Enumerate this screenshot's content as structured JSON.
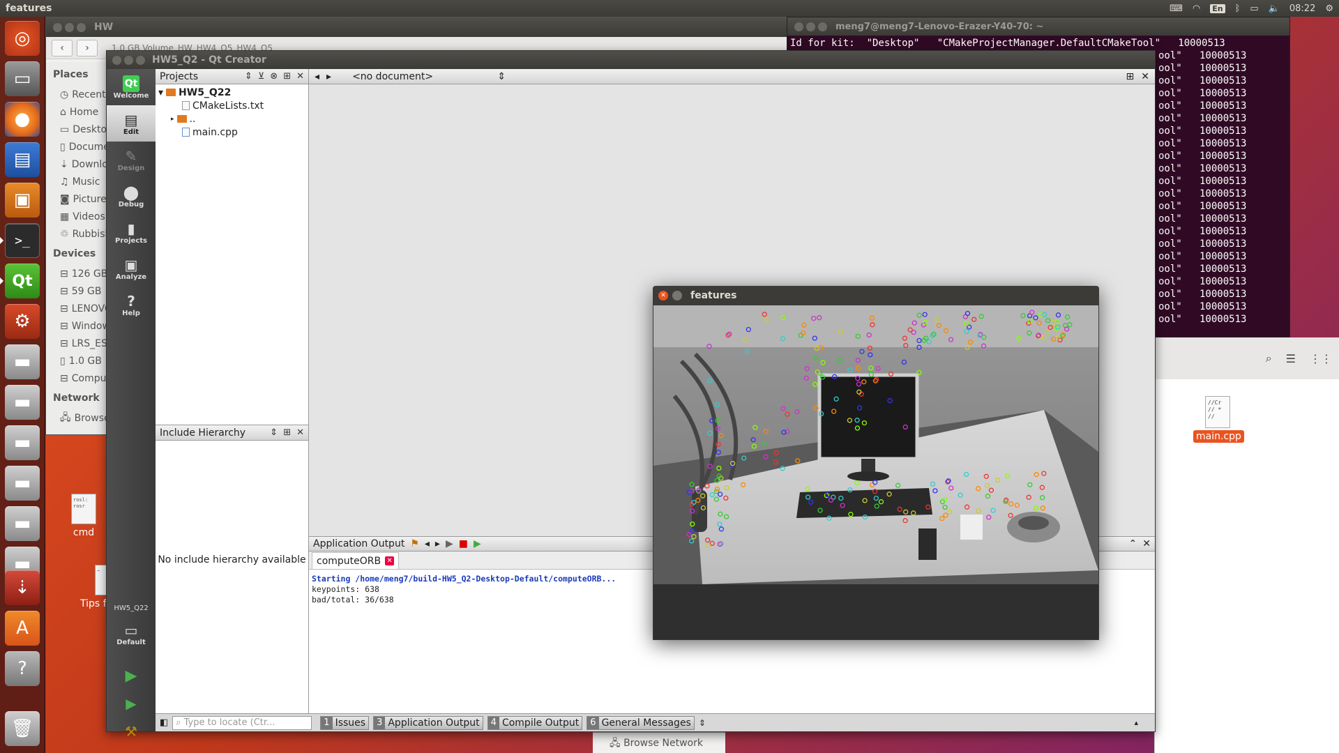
{
  "top_panel": {
    "app_title": "features",
    "lang": "En",
    "time": "08:22"
  },
  "launcher": {
    "items": [
      "ubuntu-dash",
      "files",
      "firefox",
      "writer",
      "impress",
      "terminal",
      "qt-creator",
      "system-settings",
      "drive",
      "drive",
      "drive",
      "drive",
      "drive",
      "drive",
      "usb",
      "software-center",
      "help",
      "trash"
    ]
  },
  "desktop": {
    "icon1_label": "cmd",
    "icon2_label": "Tips f",
    "browse_network": "Browse Network"
  },
  "nautilus": {
    "title": "HW",
    "tabs": [
      "1.0 GB Volume",
      "HW",
      "HW4_Q5",
      "HW4_Q5"
    ],
    "places_header": "Places",
    "places": [
      "Recent",
      "Home",
      "Desktop",
      "Documents",
      "Downloads",
      "Music",
      "Pictures",
      "Videos",
      "Rubbish Bin"
    ],
    "devices_header": "Devices",
    "devices": [
      "126 GB",
      "59 GB",
      "LENOVO",
      "Windows",
      "LRS_ESP",
      "1.0 GB",
      "Computer"
    ],
    "network_header": "Network",
    "network": [
      "Browse Network"
    ]
  },
  "terminal": {
    "title": "meng7@meng7-Lenovo-Erazer-Y40-70: ~",
    "first_line": "Id for kit:  \"Desktop\"   \"CMakeProjectManager.DefaultCMakeTool\"   10000513",
    "repeat_line": "ool\"   10000513",
    "repeat_count": 22
  },
  "files_window": {
    "file_label": "main.cpp"
  },
  "qtc": {
    "title": "HW5_Q2 - Qt Creator",
    "modes": [
      {
        "label": "Welcome",
        "icon": "qt-logo-icon"
      },
      {
        "label": "Edit",
        "icon": "edit-icon"
      },
      {
        "label": "Design",
        "icon": "design-icon"
      },
      {
        "label": "Debug",
        "icon": "debug-icon"
      },
      {
        "label": "Projects",
        "icon": "projects-icon"
      },
      {
        "label": "Analyze",
        "icon": "analyze-icon"
      },
      {
        "label": "Help",
        "icon": "help-icon"
      }
    ],
    "kit_project": "HW5_Q22",
    "kit_label": "Default",
    "projects_header": "Projects",
    "tree": {
      "root": "HW5_Q22",
      "file1": "CMakeLists.txt",
      "folder": "..",
      "file2": "main.cpp"
    },
    "include_header": "Include Hierarchy",
    "include_msg": "No include hierarchy available",
    "doc_selector": "<no document>",
    "output_header": "Application Output",
    "output_tab": "computeORB",
    "output_lines": [
      "Starting /home/meng7/build-HW5_Q2-Desktop-Default/computeORB...",
      "keypoints: 638",
      "bad/total: 36/638"
    ],
    "locate_placeholder": "Type to locate (Ctr...",
    "status_tabs": [
      {
        "num": "1",
        "label": "Issues"
      },
      {
        "num": "3",
        "label": "Application Output"
      },
      {
        "num": "4",
        "label": "Compile Output"
      },
      {
        "num": "6",
        "label": "General Messages"
      }
    ]
  },
  "features_window": {
    "title": "features"
  }
}
